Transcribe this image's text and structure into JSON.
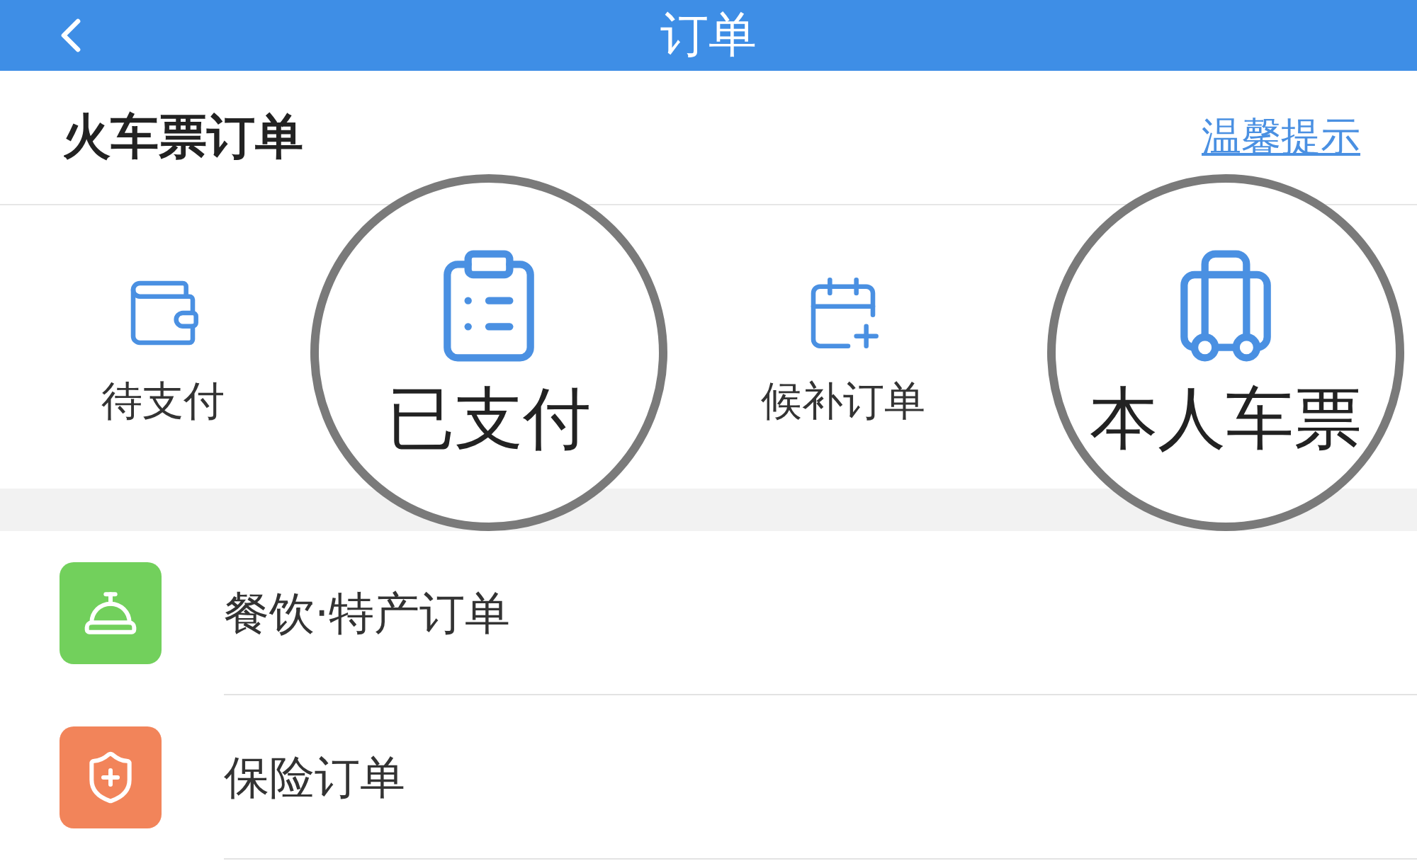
{
  "header": {
    "title": "订单"
  },
  "section": {
    "title": "火车票订单",
    "link": "温馨提示"
  },
  "order_types": [
    {
      "label": "待支付",
      "kind": "wallet",
      "magnified": false
    },
    {
      "label": "已支付",
      "kind": "clipboard",
      "magnified": true
    },
    {
      "label": "候补订单",
      "kind": "calendar",
      "magnified": false
    },
    {
      "label": "本人车票",
      "kind": "suitcase",
      "magnified": true
    }
  ],
  "list": [
    {
      "label": "餐饮·特产订单",
      "kind": "bell",
      "color": "#72d05c"
    },
    {
      "label": "保险订单",
      "kind": "shield",
      "color": "#f2845a"
    }
  ]
}
